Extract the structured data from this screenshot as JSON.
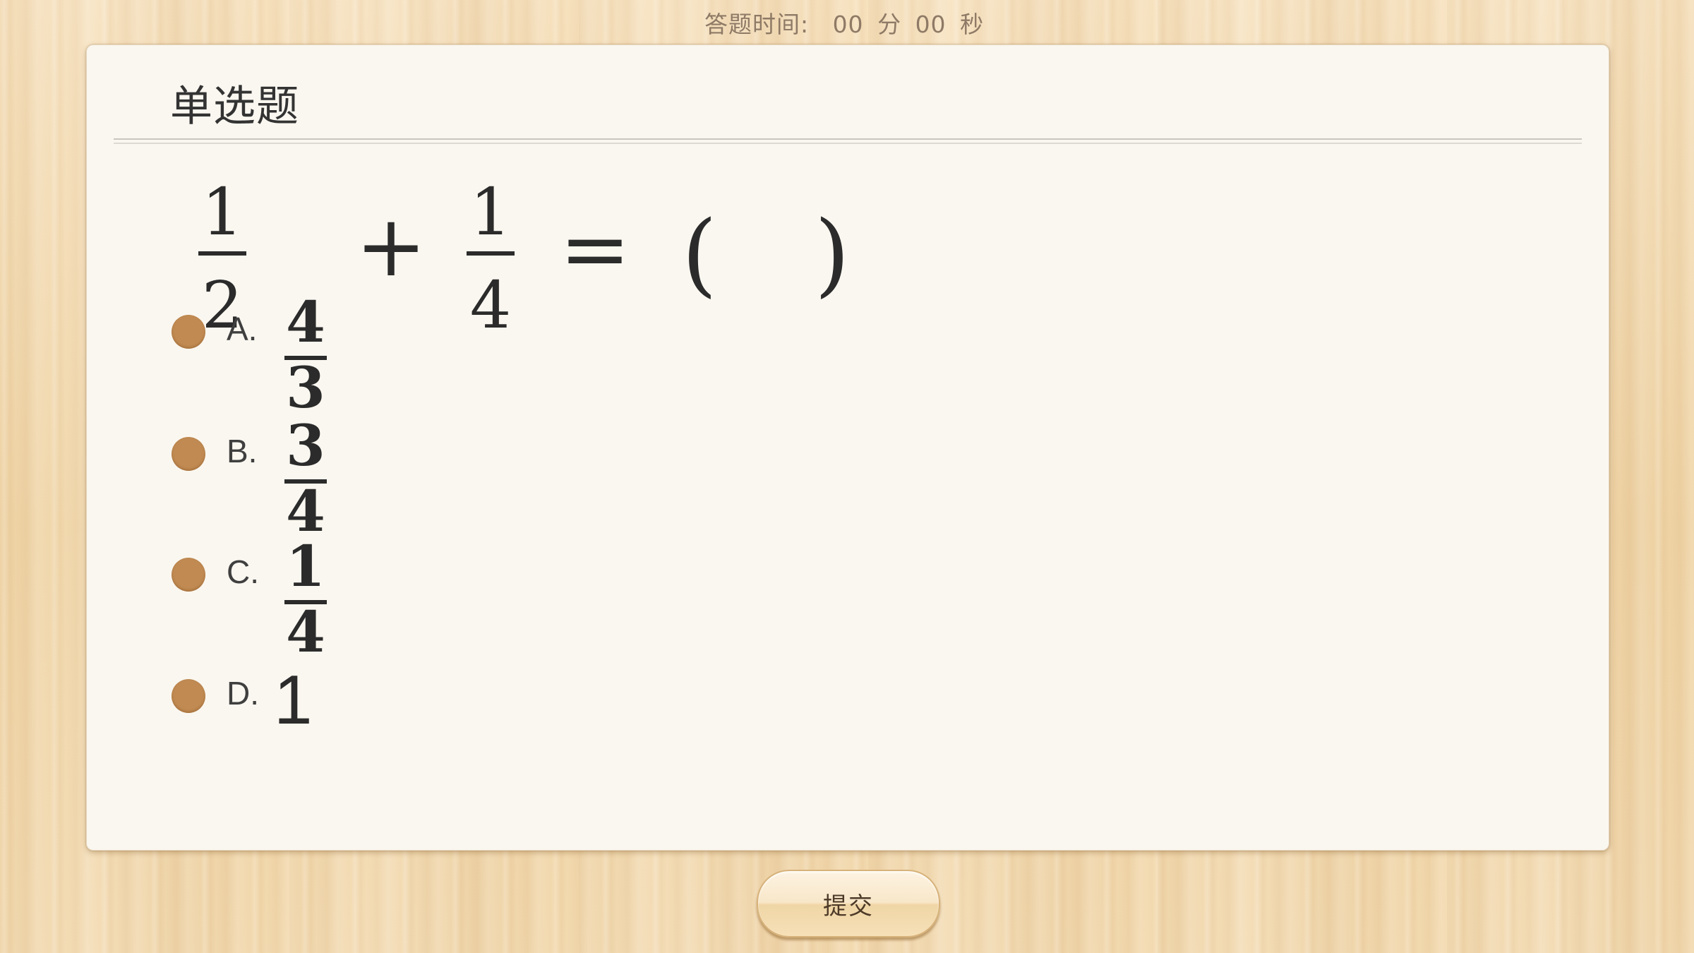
{
  "timer": {
    "label": "答题时间:",
    "minutes": "00",
    "minutes_unit": "分",
    "seconds": "00",
    "seconds_unit": "秒"
  },
  "question": {
    "type": "单选题",
    "expression": {
      "term1": {
        "numerator": "1",
        "denominator": "2"
      },
      "operator": "+",
      "term2": {
        "numerator": "1",
        "denominator": "4"
      },
      "equals": "=",
      "open_paren": "(",
      "close_paren": ")"
    }
  },
  "options": [
    {
      "letter": "A.",
      "numerator": "4",
      "denominator": "3"
    },
    {
      "letter": "B.",
      "numerator": "3",
      "denominator": "4"
    },
    {
      "letter": "C.",
      "numerator": "1",
      "denominator": "4"
    },
    {
      "letter": "D.",
      "value": "1"
    }
  ],
  "submit": {
    "label": "提交"
  },
  "colors": {
    "radio": "#c08a52",
    "card": "#faf7f0",
    "background": "#f3d9ae"
  }
}
